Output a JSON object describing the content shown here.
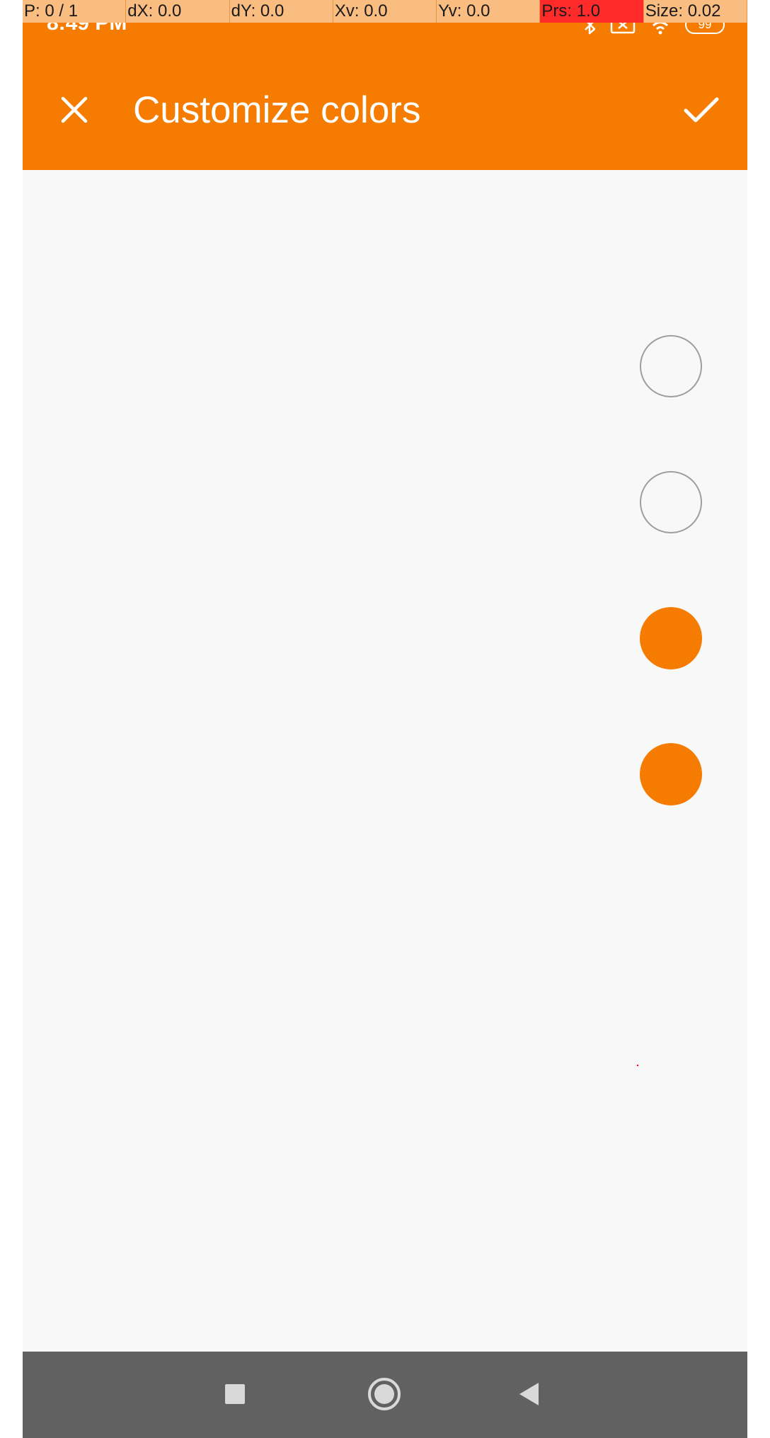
{
  "debug": {
    "p": "P: 0 / 1",
    "dx": "dX: 0.0",
    "dy": "dY: 0.0",
    "xv": "Xv: 0.0",
    "yv": "Yv: 0.0",
    "prs": "Prs: 1.0",
    "size": "Size: 0.02"
  },
  "status_bar": {
    "time": "8:49 PM",
    "battery": "99",
    "icons": [
      "bluetooth-icon",
      "sim-icon",
      "wifi-icon",
      "battery-icon"
    ]
  },
  "toolbar": {
    "title": "Customize colors",
    "close_icon": "close-icon",
    "confirm_icon": "check-icon"
  },
  "swatches": [
    {
      "style": "outlined"
    },
    {
      "style": "outlined"
    },
    {
      "style": "filled",
      "color": "#f57c00"
    },
    {
      "style": "filled",
      "color": "#f57c00"
    }
  ],
  "colors": {
    "accent": "#f57c00",
    "background": "#f8f8f8",
    "navbar": "#616161",
    "swatch_outline": "#9e9e9e"
  },
  "navbar": {
    "icons": [
      "recents-square-icon",
      "home-circle-icon",
      "back-triangle-icon"
    ]
  }
}
